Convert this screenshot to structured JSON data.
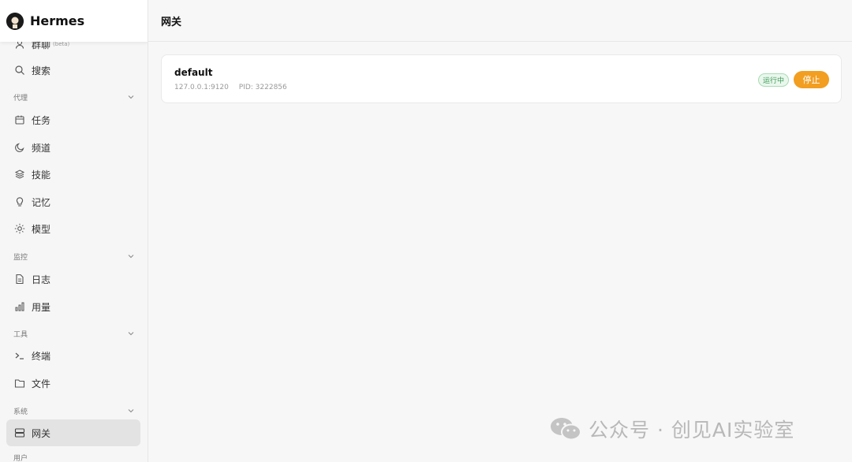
{
  "brand": {
    "name": "Hermes"
  },
  "header": {
    "title": "网关"
  },
  "sidebar": {
    "items": [
      {
        "label": "群聊",
        "badge": "(beta)",
        "icon": "user-icon"
      },
      {
        "label": "搜索",
        "icon": "search-icon"
      },
      {
        "label": "任务",
        "icon": "calendar-icon"
      },
      {
        "label": "频道",
        "icon": "moon-icon"
      },
      {
        "label": "技能",
        "icon": "layers-icon"
      },
      {
        "label": "记忆",
        "icon": "lightbulb-icon"
      },
      {
        "label": "模型",
        "icon": "sun-icon"
      },
      {
        "label": "日志",
        "icon": "file-text-icon"
      },
      {
        "label": "用量",
        "icon": "bar-chart-icon"
      },
      {
        "label": "终端",
        "icon": "terminal-icon"
      },
      {
        "label": "文件",
        "icon": "folder-icon"
      },
      {
        "label": "网关",
        "icon": "server-icon",
        "active": true
      }
    ],
    "sections": [
      {
        "label": "代理"
      },
      {
        "label": "监控"
      },
      {
        "label": "工具"
      },
      {
        "label": "系统"
      },
      {
        "label": "用户"
      }
    ]
  },
  "gateway": {
    "name": "default",
    "address": "127.0.0.1:9120",
    "pid": "PID: 3222856",
    "status": "运行中",
    "stop_label": "停止"
  },
  "watermark": {
    "text": "公众号 · 创见AI实验室"
  },
  "colors": {
    "accent": "#f29e20",
    "status_green": "#3a9a55",
    "active_bg": "#e3e3e3"
  }
}
